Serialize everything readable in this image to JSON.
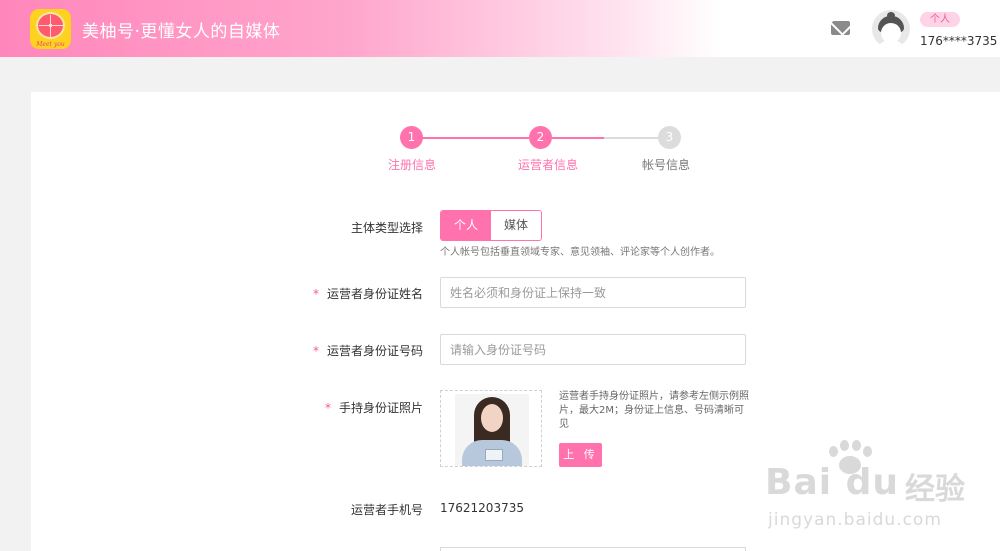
{
  "header": {
    "app_title": "美柚号·更懂女人的自媒体",
    "logo_caption": "Meet you",
    "role_badge": "个人",
    "phone": "176****3735"
  },
  "stepper": {
    "steps": [
      {
        "num": "1",
        "label": "注册信息",
        "state": "done"
      },
      {
        "num": "2",
        "label": "运营者信息",
        "state": "active"
      },
      {
        "num": "3",
        "label": "帐号信息",
        "state": "todo"
      }
    ]
  },
  "form": {
    "entity_type_label": "主体类型选择",
    "entity_options": [
      "个人",
      "媒体"
    ],
    "entity_selected": "个人",
    "entity_hint": "个人帐号包括垂直领域专家、意见领袖、评论家等个人创作者。",
    "required_mark": "*",
    "name_label": "运营者身份证姓名",
    "name_placeholder": "姓名必须和身份证上保持一致",
    "id_label": "运营者身份证号码",
    "id_placeholder": "请输入身份证号码",
    "photo_label": "手持身份证照片",
    "photo_desc": "运营者手持身份证照片，请参考左侧示例照片，最大2M；身份证上信息、号码清晰可见",
    "upload_label": "上 传",
    "phone_label": "运营者手机号",
    "phone_value": "17621203735"
  },
  "watermark": {
    "brand": "Bai du",
    "cn": "经验",
    "url": "jingyan.baidu.com"
  },
  "colors": {
    "accent": "#ff72ad",
    "accent_light": "#ffd3e6",
    "inactive_step": "#dcdcdc"
  }
}
